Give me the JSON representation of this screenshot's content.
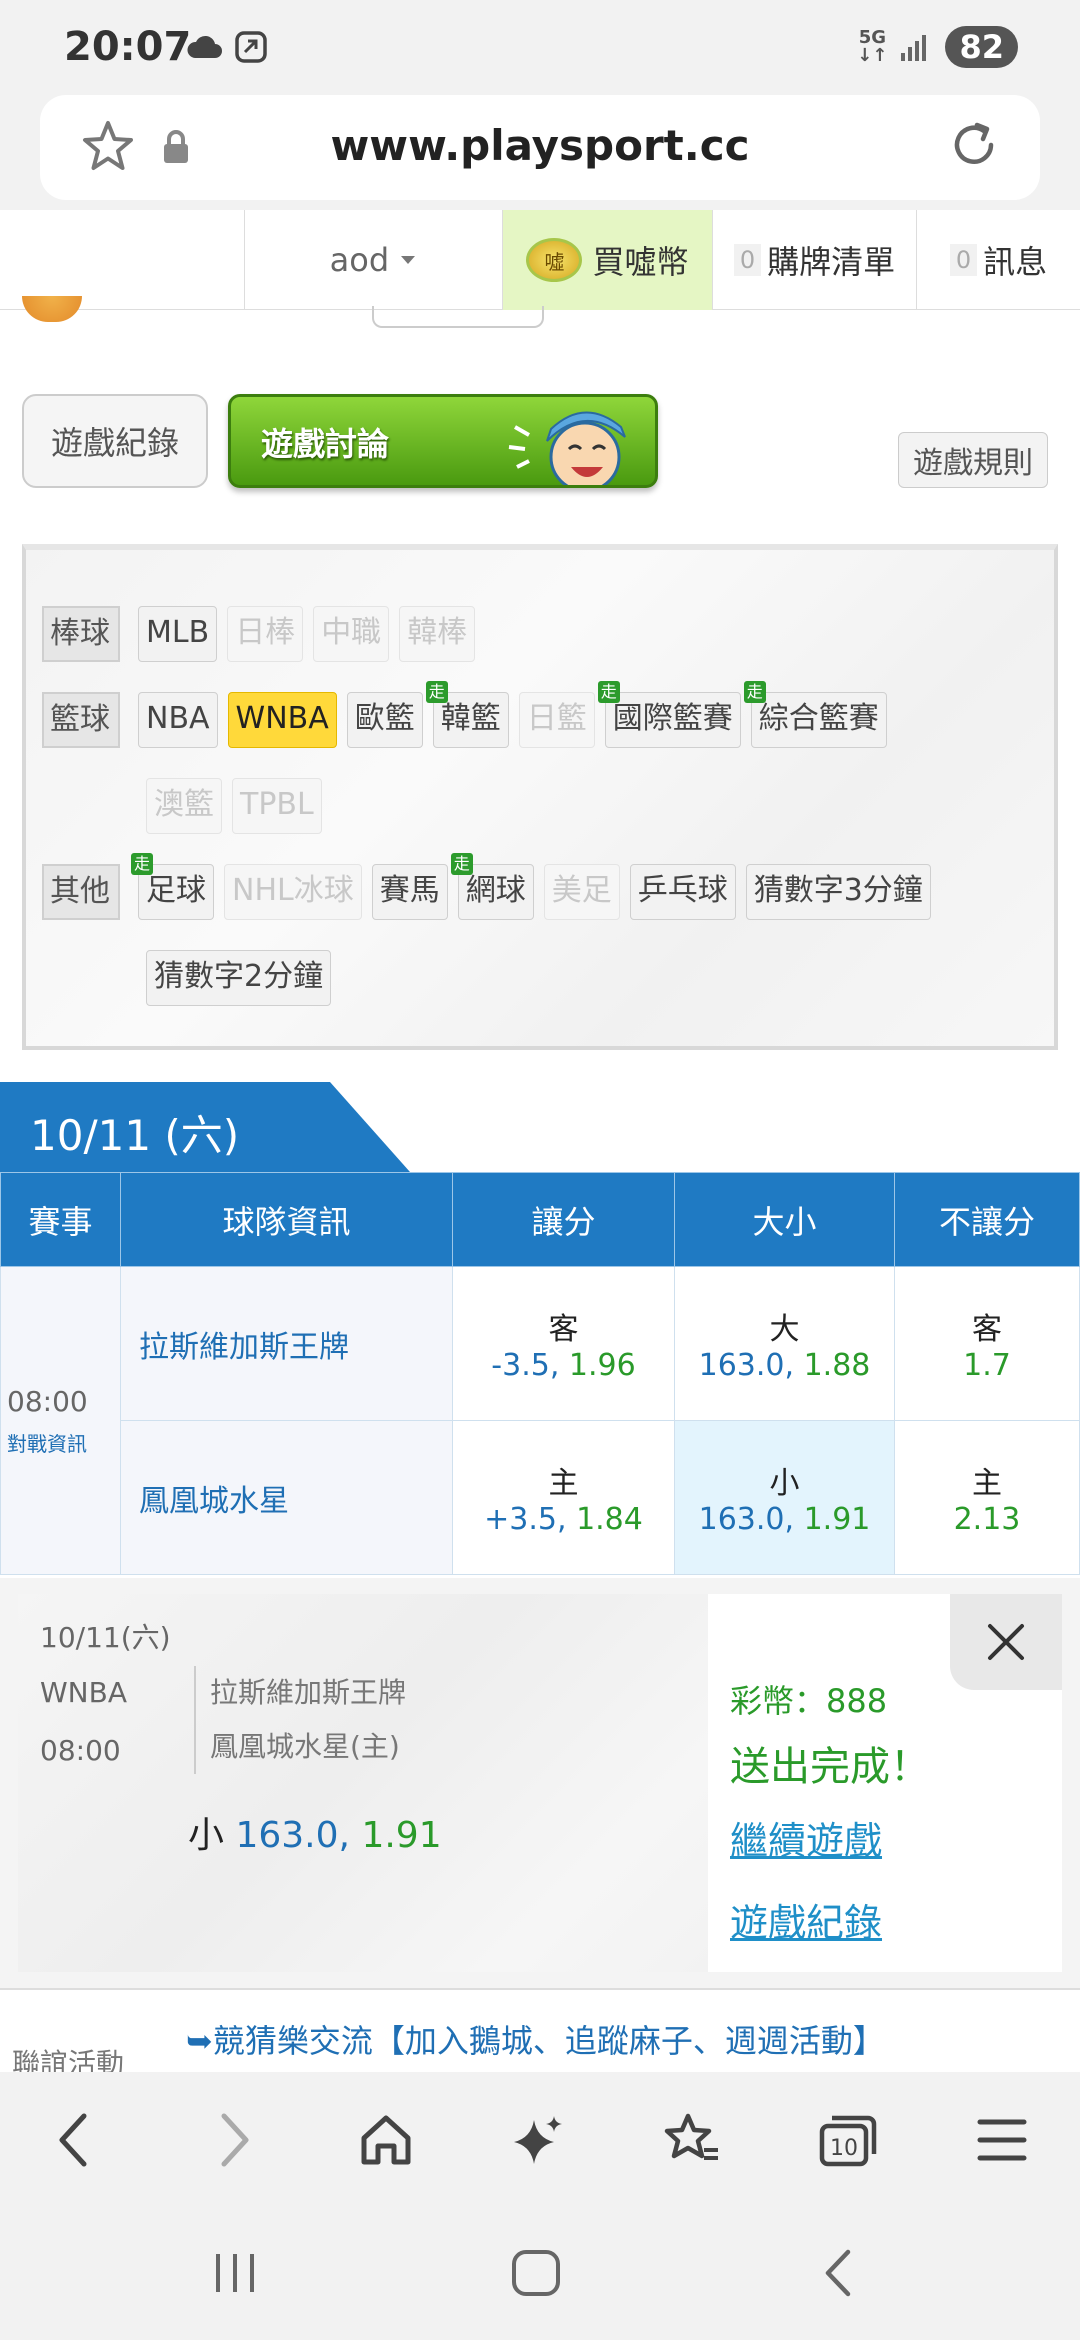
{
  "status": {
    "time": "20:07",
    "network": "5G",
    "battery": "82"
  },
  "browser": {
    "url": "www.playsport.cc",
    "tab_count": "10"
  },
  "header": {
    "user": "aod",
    "buy_coins": "買噓幣",
    "coin_glyph": "噓",
    "cart_count": "0",
    "cart": "購牌清單",
    "msg_count": "0",
    "messages": "訊息"
  },
  "game_buttons": {
    "record": "遊戲紀錄",
    "discuss": "遊戲討論",
    "rules": "遊戲規則"
  },
  "categories": {
    "walk_badge": "走",
    "baseball": {
      "title": "棒球",
      "items": [
        "MLB",
        "日棒",
        "中職",
        "韓棒"
      ]
    },
    "basketball": {
      "title": "籃球",
      "items": [
        "NBA",
        "WNBA",
        "歐籃",
        "韓籃",
        "日籃",
        "國際籃賽",
        "綜合籃賽",
        "澳籃",
        "TPBL"
      ]
    },
    "other": {
      "title": "其他",
      "items": [
        "足球",
        "NHL冰球",
        "賽馬",
        "網球",
        "美足",
        "乒乓球",
        "猜數字3分鐘",
        "猜數字2分鐘"
      ]
    }
  },
  "date_tab": "10/11 (六)",
  "table": {
    "headers": [
      "賽事",
      "球隊資訊",
      "讓分",
      "大小",
      "不讓分"
    ],
    "time": "08:00",
    "match_info": "對戰資訊",
    "rows": [
      {
        "team": "拉斯維加斯王牌",
        "spread_side": "客",
        "spread_val": "-3.5,",
        "spread_odds": "1.96",
        "total_side": "大",
        "total_val": "163.0,",
        "total_odds": "1.88",
        "ml_side": "客",
        "ml_odds": "1.7"
      },
      {
        "team": "鳳凰城水星",
        "spread_side": "主",
        "spread_val": "+3.5,",
        "spread_odds": "1.84",
        "total_side": "小",
        "total_val": "163.0,",
        "total_odds": "1.91",
        "ml_side": "主",
        "ml_odds": "2.13"
      }
    ]
  },
  "confirm": {
    "date": "10/11(六)",
    "league": "WNBA",
    "time": "08:00",
    "away": "拉斯維加斯王牌",
    "home": "鳳凰城水星(主)",
    "pick_side": "小",
    "pick_val": "163.0,",
    "pick_odds": "1.91",
    "coins": "彩幣：888",
    "sent": "送出完成！",
    "continue": "繼續遊戲",
    "record": "遊戲紀錄"
  },
  "promo": {
    "text": "➥競猜樂交流【加入鵝城、追蹤麻子、週週活動】",
    "cut_label": "聯誼活動"
  },
  "colors": {
    "accent_blue": "#1f7ac3",
    "green": "#2a9a2a",
    "highlight": "#ffd93a"
  }
}
